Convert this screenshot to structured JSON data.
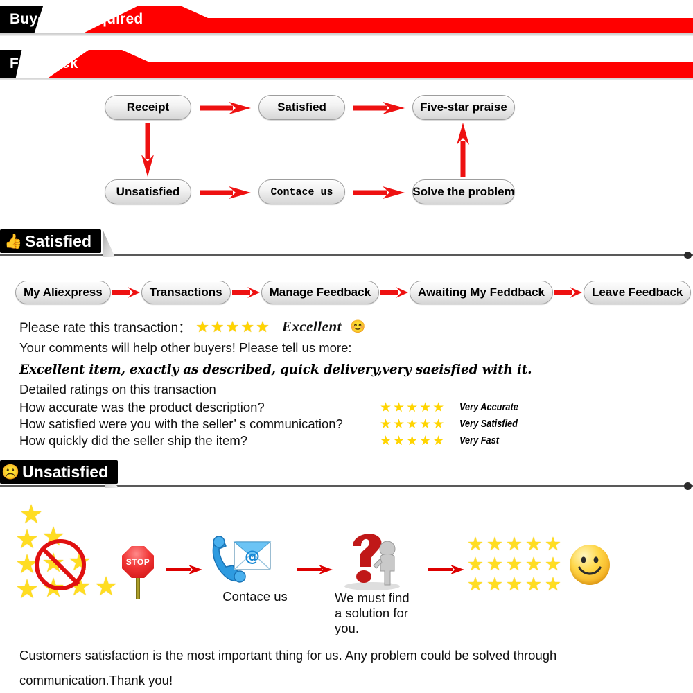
{
  "banners": [
    {
      "label": "Buyers & Required",
      "black_hex": "#000000",
      "red_hex": "#FF0000"
    },
    {
      "label": "Feedback",
      "black_hex": "#000000",
      "red_hex": "#FF0000"
    }
  ],
  "flowchart": {
    "nodes": [
      {
        "label": "Receipt"
      },
      {
        "label": "Satisfied"
      },
      {
        "label": "Five-star praise"
      },
      {
        "label": "Unsatisfied"
      },
      {
        "label": "Contace us"
      },
      {
        "label": "Solve the problem"
      }
    ],
    "arrow_color": "#EE1111"
  },
  "satisfied_section": {
    "title": "Satisfied",
    "icon": "thumbs-up-icon",
    "breadcrumb": [
      "My Aliexpress",
      "Transactions",
      "Manage Feedback",
      "Awaiting My Feddback",
      "Leave Feedback"
    ],
    "rate_prompt": "Please rate this transaction：",
    "rate_stars": "★★★★★",
    "rate_word": "Excellent",
    "rate_smiley": "smiley-face-icon",
    "comments_prompt": "Your comments will help other buyers! Please tell us more:",
    "review_text": "Excellent item, exactly as described, quick delivery,very saeisfied with it.",
    "detailed_title": "Detailed ratings on this transaction",
    "detailed_rows": [
      {
        "question": "How accurate was the product description?",
        "stars": "★★★★★",
        "label": "Very Accurate"
      },
      {
        "question": "How satisfied were you with the seller’ s communication?",
        "stars": "★★★★★",
        "label": "Very Satisfied"
      },
      {
        "question": "How quickly did the seller ship the item?",
        "stars": "★★★★★",
        "label": "Very Fast"
      }
    ]
  },
  "unsatisfied_section": {
    "title": "Unsatisfied",
    "icon": "frowning-face-icon",
    "graphics": {
      "no_stars_icon": "no-bad-rating-icon",
      "stop_label": "STOP",
      "contact_icon": "phone-email-icon",
      "contact_label": "Contace us",
      "solution_icon": "question-mark-figure-icon",
      "solution_label": "We must find\na solution for\nyou.",
      "five_star_grid_icon": "five-star-grid-icon",
      "smiley_icon": "big-smiley-face-icon"
    }
  },
  "footer": {
    "text": "Customers satisfaction is the most important thing for us. Any problem could be solved through communication.Thank you!"
  },
  "colors": {
    "banner_red": "#FF0000",
    "banner_black": "#000000",
    "star_gold": "#FFDD22",
    "arrow_red": "#EE1111",
    "rule_gray": "#595959"
  }
}
